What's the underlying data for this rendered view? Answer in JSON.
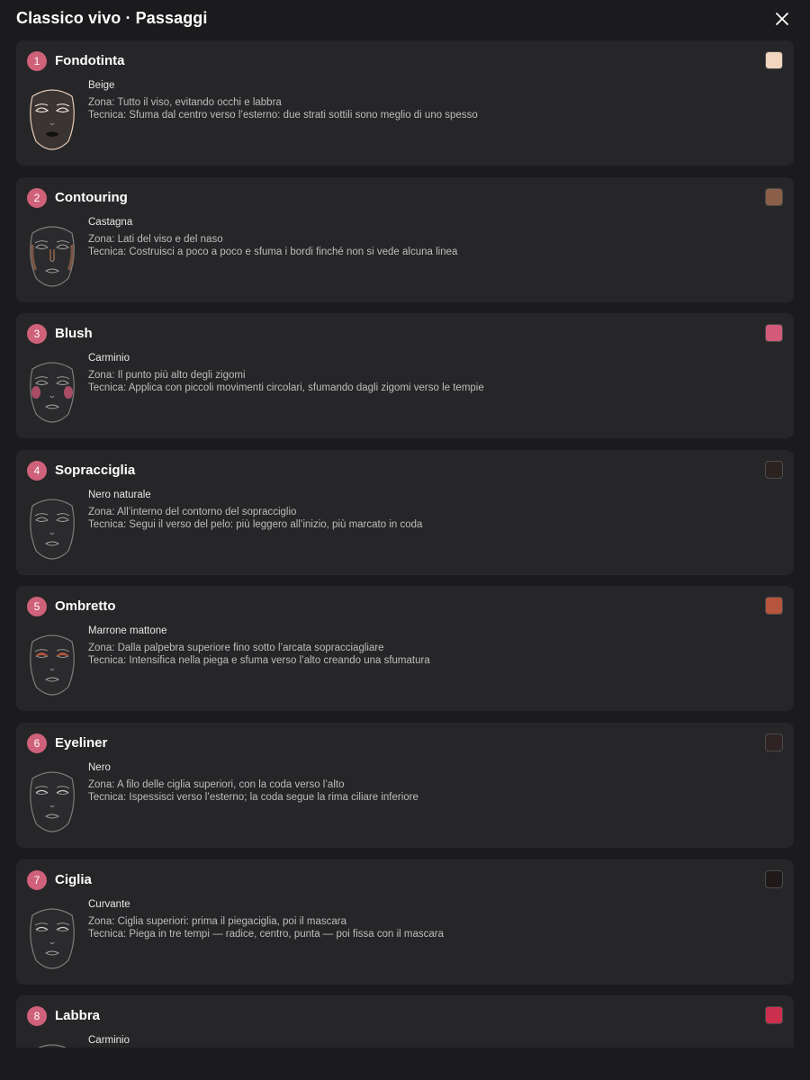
{
  "header": {
    "title": "Classico vivo · Passaggi",
    "close_icon": "close-icon"
  },
  "accent": "#d0617a",
  "steps": [
    {
      "number": "1",
      "title": "Fondotinta",
      "shade": "Beige",
      "zone": "Zona: Tutto il viso, evitando occhi e labbra",
      "technique": "Tecnica: Sfuma dal centro verso l’esterno: due strati sottili sono meglio di uno spesso",
      "color": "#f1d6c0",
      "face": "foundation"
    },
    {
      "number": "2",
      "title": "Contouring",
      "shade": "Castagna",
      "zone": "Zona: Lati del viso e del naso",
      "technique": "Tecnica: Costruisci a poco a poco e sfuma i bordi finché non si vede alcuna linea",
      "color": "#8c5f48",
      "face": "contour"
    },
    {
      "number": "3",
      "title": "Blush",
      "shade": "Carminio",
      "zone": "Zona: Il punto più alto degli zigomi",
      "technique": "Tecnica: Applica con piccoli movimenti circolari, sfumando dagli zigomi verso le tempie",
      "color": "#d35a78",
      "face": "blush"
    },
    {
      "number": "4",
      "title": "Sopracciglia",
      "shade": "Nero naturale",
      "zone": "Zona: All’interno del contorno del sopracciglio",
      "technique": "Tecnica: Segui il verso del pelo: più leggero all’inizio, più marcato in coda",
      "color": "#2c2320",
      "face": "brows"
    },
    {
      "number": "5",
      "title": "Ombretto",
      "shade": "Marrone mattone",
      "zone": "Zona: Dalla palpebra superiore fino sotto l’arcata sopracciagliare",
      "technique": "Tecnica: Intensifica nella piega e sfuma verso l’alto creando una sfumatura",
      "color": "#b5553d",
      "face": "shadow"
    },
    {
      "number": "6",
      "title": "Eyeliner",
      "shade": "Nero",
      "zone": "Zona: A filo delle ciglia superiori, con la coda verso l’alto",
      "technique": "Tecnica: Ispessisci verso l’esterno; la coda segue la rima ciliare inferiore",
      "color": "#2e2322",
      "face": "liner"
    },
    {
      "number": "7",
      "title": "Ciglia",
      "shade": "Curvante",
      "zone": "Zona: Ciglia superiori: prima il piegaciglia, poi il mascara",
      "technique": "Tecnica: Piega in tre tempi — radice, centro, punta — poi fissa con il mascara",
      "color": "#1f1a19",
      "face": "lashes"
    },
    {
      "number": "8",
      "title": "Labbra",
      "shade": "Carminio",
      "zone": "",
      "technique": "",
      "color": "#cc2f4e",
      "face": "lips"
    }
  ]
}
